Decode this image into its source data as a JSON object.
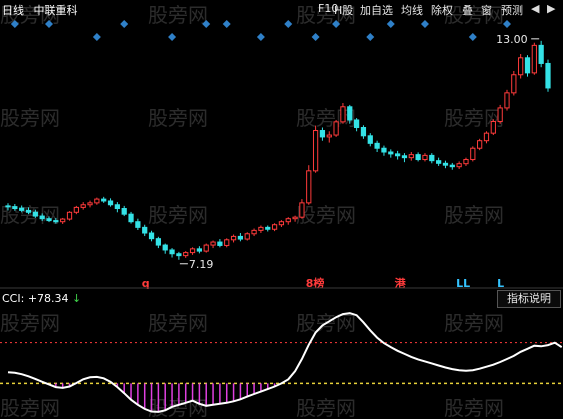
{
  "header": {
    "period": "日线",
    "stock_name": "中联重科",
    "buttons": [
      "F10",
      "H股",
      "加自选",
      "均线",
      "除权",
      "叠",
      "窗",
      "预测"
    ],
    "nav_arrows": [
      "◀",
      "▶"
    ]
  },
  "watermark": "股 旁 网",
  "indicator": {
    "name": "CCI",
    "value": "+78.34",
    "arrow": "↓",
    "button": "指标说明"
  },
  "colors": {
    "up": "#ff3b3b",
    "down": "#34e2e6",
    "cci": "#ffffff",
    "diamond": "#2f80c8",
    "ref_line": "#e8d23a",
    "ref_line_red": "#ff3b3b",
    "below_fill": "#e040e0"
  },
  "chart_data": {
    "type": "candlestick",
    "title": "",
    "price_annotations": {
      "high": "13.00",
      "low": "7.19"
    },
    "candles": [
      {
        "o": 8.62,
        "h": 8.69,
        "l": 8.5,
        "c": 8.6
      },
      {
        "o": 8.6,
        "h": 8.67,
        "l": 8.49,
        "c": 8.55
      },
      {
        "o": 8.56,
        "h": 8.63,
        "l": 8.45,
        "c": 8.5
      },
      {
        "o": 8.5,
        "h": 8.58,
        "l": 8.4,
        "c": 8.45
      },
      {
        "o": 8.45,
        "h": 8.52,
        "l": 8.3,
        "c": 8.35
      },
      {
        "o": 8.35,
        "h": 8.42,
        "l": 8.22,
        "c": 8.28
      },
      {
        "o": 8.28,
        "h": 8.34,
        "l": 8.19,
        "c": 8.23
      },
      {
        "o": 8.23,
        "h": 8.3,
        "l": 8.15,
        "c": 8.2
      },
      {
        "o": 8.2,
        "h": 8.3,
        "l": 8.14,
        "c": 8.27
      },
      {
        "o": 8.27,
        "h": 8.48,
        "l": 8.23,
        "c": 8.45
      },
      {
        "o": 8.45,
        "h": 8.62,
        "l": 8.4,
        "c": 8.58
      },
      {
        "o": 8.58,
        "h": 8.72,
        "l": 8.52,
        "c": 8.65
      },
      {
        "o": 8.65,
        "h": 8.76,
        "l": 8.58,
        "c": 8.7
      },
      {
        "o": 8.7,
        "h": 8.84,
        "l": 8.65,
        "c": 8.8
      },
      {
        "o": 8.8,
        "h": 8.86,
        "l": 8.7,
        "c": 8.75
      },
      {
        "o": 8.75,
        "h": 8.82,
        "l": 8.6,
        "c": 8.65
      },
      {
        "o": 8.65,
        "h": 8.72,
        "l": 8.45,
        "c": 8.55
      },
      {
        "o": 8.55,
        "h": 8.62,
        "l": 8.35,
        "c": 8.4
      },
      {
        "o": 8.4,
        "h": 8.46,
        "l": 8.15,
        "c": 8.2
      },
      {
        "o": 8.2,
        "h": 8.28,
        "l": 7.98,
        "c": 8.05
      },
      {
        "o": 8.05,
        "h": 8.12,
        "l": 7.82,
        "c": 7.9
      },
      {
        "o": 7.9,
        "h": 7.96,
        "l": 7.68,
        "c": 7.75
      },
      {
        "o": 7.75,
        "h": 7.8,
        "l": 7.5,
        "c": 7.58
      },
      {
        "o": 7.58,
        "h": 7.62,
        "l": 7.35,
        "c": 7.45
      },
      {
        "o": 7.45,
        "h": 7.5,
        "l": 7.25,
        "c": 7.35
      },
      {
        "o": 7.35,
        "h": 7.4,
        "l": 7.19,
        "c": 7.3
      },
      {
        "o": 7.3,
        "h": 7.42,
        "l": 7.24,
        "c": 7.38
      },
      {
        "o": 7.38,
        "h": 7.52,
        "l": 7.32,
        "c": 7.48
      },
      {
        "o": 7.48,
        "h": 7.55,
        "l": 7.36,
        "c": 7.42
      },
      {
        "o": 7.42,
        "h": 7.62,
        "l": 7.38,
        "c": 7.58
      },
      {
        "o": 7.58,
        "h": 7.7,
        "l": 7.5,
        "c": 7.66
      },
      {
        "o": 7.66,
        "h": 7.74,
        "l": 7.52,
        "c": 7.57
      },
      {
        "o": 7.57,
        "h": 7.76,
        "l": 7.52,
        "c": 7.72
      },
      {
        "o": 7.72,
        "h": 7.86,
        "l": 7.65,
        "c": 7.81
      },
      {
        "o": 7.81,
        "h": 7.9,
        "l": 7.68,
        "c": 7.74
      },
      {
        "o": 7.74,
        "h": 7.92,
        "l": 7.7,
        "c": 7.88
      },
      {
        "o": 7.88,
        "h": 8.02,
        "l": 7.82,
        "c": 7.97
      },
      {
        "o": 7.97,
        "h": 8.1,
        "l": 7.9,
        "c": 8.05
      },
      {
        "o": 8.05,
        "h": 8.1,
        "l": 7.94,
        "c": 8.0
      },
      {
        "o": 8.0,
        "h": 8.16,
        "l": 7.95,
        "c": 8.12
      },
      {
        "o": 8.12,
        "h": 8.24,
        "l": 8.06,
        "c": 8.2
      },
      {
        "o": 8.2,
        "h": 8.32,
        "l": 8.12,
        "c": 8.28
      },
      {
        "o": 8.28,
        "h": 8.36,
        "l": 8.2,
        "c": 8.32
      },
      {
        "o": 8.32,
        "h": 8.8,
        "l": 8.28,
        "c": 8.7
      },
      {
        "o": 8.7,
        "h": 9.7,
        "l": 8.65,
        "c": 9.55
      },
      {
        "o": 9.55,
        "h": 10.75,
        "l": 9.5,
        "c": 10.62
      },
      {
        "o": 10.62,
        "h": 10.7,
        "l": 10.35,
        "c": 10.45
      },
      {
        "o": 10.45,
        "h": 10.6,
        "l": 10.3,
        "c": 10.5
      },
      {
        "o": 10.5,
        "h": 10.9,
        "l": 10.45,
        "c": 10.85
      },
      {
        "o": 10.85,
        "h": 11.35,
        "l": 10.8,
        "c": 11.25
      },
      {
        "o": 11.25,
        "h": 11.3,
        "l": 10.8,
        "c": 10.9
      },
      {
        "o": 10.9,
        "h": 10.95,
        "l": 10.6,
        "c": 10.7
      },
      {
        "o": 10.7,
        "h": 10.76,
        "l": 10.4,
        "c": 10.48
      },
      {
        "o": 10.48,
        "h": 10.55,
        "l": 10.2,
        "c": 10.28
      },
      {
        "o": 10.28,
        "h": 10.35,
        "l": 10.05,
        "c": 10.15
      },
      {
        "o": 10.15,
        "h": 10.22,
        "l": 9.95,
        "c": 10.05
      },
      {
        "o": 10.05,
        "h": 10.12,
        "l": 9.9,
        "c": 10.0
      },
      {
        "o": 10.0,
        "h": 10.08,
        "l": 9.85,
        "c": 9.95
      },
      {
        "o": 9.95,
        "h": 10.02,
        "l": 9.78,
        "c": 9.9
      },
      {
        "o": 9.9,
        "h": 10.05,
        "l": 9.82,
        "c": 9.98
      },
      {
        "o": 9.98,
        "h": 10.04,
        "l": 9.8,
        "c": 9.85
      },
      {
        "o": 9.85,
        "h": 10.02,
        "l": 9.8,
        "c": 9.96
      },
      {
        "o": 9.96,
        "h": 10.02,
        "l": 9.75,
        "c": 9.82
      },
      {
        "o": 9.82,
        "h": 9.9,
        "l": 9.68,
        "c": 9.75
      },
      {
        "o": 9.75,
        "h": 9.82,
        "l": 9.62,
        "c": 9.7
      },
      {
        "o": 9.7,
        "h": 9.76,
        "l": 9.58,
        "c": 9.66
      },
      {
        "o": 9.66,
        "h": 9.8,
        "l": 9.6,
        "c": 9.74
      },
      {
        "o": 9.74,
        "h": 9.9,
        "l": 9.68,
        "c": 9.85
      },
      {
        "o": 9.85,
        "h": 10.2,
        "l": 9.8,
        "c": 10.15
      },
      {
        "o": 10.15,
        "h": 10.4,
        "l": 10.1,
        "c": 10.35
      },
      {
        "o": 10.35,
        "h": 10.6,
        "l": 10.28,
        "c": 10.55
      },
      {
        "o": 10.55,
        "h": 10.92,
        "l": 10.5,
        "c": 10.86
      },
      {
        "o": 10.86,
        "h": 11.3,
        "l": 10.8,
        "c": 11.22
      },
      {
        "o": 11.22,
        "h": 11.7,
        "l": 11.15,
        "c": 11.62
      },
      {
        "o": 11.62,
        "h": 12.2,
        "l": 11.55,
        "c": 12.1
      },
      {
        "o": 12.1,
        "h": 12.65,
        "l": 12.0,
        "c": 12.55
      },
      {
        "o": 12.55,
        "h": 12.62,
        "l": 12.05,
        "c": 12.15
      },
      {
        "o": 12.15,
        "h": 12.95,
        "l": 12.1,
        "c": 12.88
      },
      {
        "o": 12.88,
        "h": 13.0,
        "l": 12.3,
        "c": 12.4
      },
      {
        "o": 12.4,
        "h": 12.5,
        "l": 11.65,
        "c": 11.75
      }
    ],
    "cci": [
      -45,
      -48,
      -55,
      -65,
      -78,
      -92,
      -105,
      -118,
      -122,
      -115,
      -98,
      -80,
      -70,
      -68,
      -75,
      -92,
      -118,
      -148,
      -180,
      -205,
      -225,
      -238,
      -240,
      -232,
      -215,
      -205,
      -195,
      -185,
      -200,
      -210,
      -205,
      -200,
      -195,
      -188,
      -178,
      -165,
      -152,
      -140,
      -128,
      -115,
      -100,
      -80,
      -40,
      20,
      90,
      150,
      185,
      205,
      225,
      240,
      245,
      235,
      200,
      160,
      125,
      98,
      78,
      60,
      45,
      30,
      18,
      8,
      -2,
      -12,
      -22,
      -30,
      -35,
      -38,
      -35,
      -28,
      -18,
      -8,
      5,
      20,
      35,
      55,
      70,
      85,
      82,
      88,
      100,
      78
    ],
    "cci_reference": [
      100,
      -100
    ],
    "signal_markers": [
      {
        "index": 20,
        "label": "q",
        "color": "#ff3b3b"
      },
      {
        "index": 44,
        "label": "8榜",
        "color": "#ff3b3b"
      },
      {
        "index": 57,
        "label": "港",
        "color": "#ff3b3b"
      },
      {
        "index": 66,
        "label": "LL",
        "color": "#34c4ff"
      },
      {
        "index": 72,
        "label": "L",
        "color": "#34c4ff"
      }
    ],
    "diamond_markers": [
      {
        "index": 1,
        "row": 1
      },
      {
        "index": 6,
        "row": 1
      },
      {
        "index": 13,
        "row": 2
      },
      {
        "index": 17,
        "row": 1
      },
      {
        "index": 24,
        "row": 2
      },
      {
        "index": 29,
        "row": 1
      },
      {
        "index": 32,
        "row": 1
      },
      {
        "index": 37,
        "row": 2
      },
      {
        "index": 41,
        "row": 1
      },
      {
        "index": 45,
        "row": 2
      },
      {
        "index": 48,
        "row": 1
      },
      {
        "index": 53,
        "row": 2
      },
      {
        "index": 56,
        "row": 1
      },
      {
        "index": 61,
        "row": 1
      },
      {
        "index": 68,
        "row": 2
      },
      {
        "index": 73,
        "row": 1
      }
    ],
    "price_range": [
      6.6,
      13.5
    ],
    "cci_range": [
      -260,
      280
    ]
  }
}
